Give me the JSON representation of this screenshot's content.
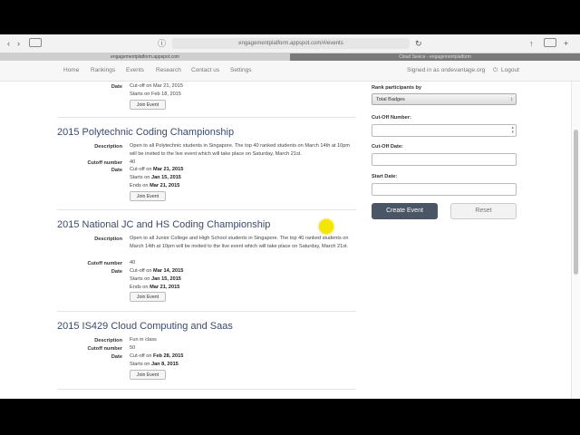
{
  "browser": {
    "url": "engagementplatform.appspot.com/#/events",
    "tab_left": "engagementplatform.appspot.com",
    "tab_right": "Cloud Sevice - engagementplatform"
  },
  "nav": {
    "items": [
      "Home",
      "Rankings",
      "Events",
      "Research",
      "Contact us",
      "Settings"
    ],
    "signed_in": "Signed in as ondevantage.org",
    "logout": "Logout"
  },
  "top_partial": {
    "date_label": "Date",
    "cutoff": "Cut-off on Mar 21, 2015",
    "starts": "Starts on Feb 18, 2015",
    "join": "Join Event"
  },
  "events": [
    {
      "title": "2015 Polytechnic Coding Championship",
      "description": "Open to all Polytechnic students in Singapore. The top 40 ranked students on March 14th at 10pm will be invited to the live event which will take place on Saturday, March 21st.",
      "cutoff_number": "40",
      "cutoff_prefix": "Cut-off on ",
      "cutoff_date": "Mar 21, 2015",
      "starts_prefix": "Starts on ",
      "starts_date": "Jan 15, 2015",
      "ends_prefix": "Ends on ",
      "ends_date": "Mar 21, 2015",
      "join": "Join Event"
    },
    {
      "title": "2015 National JC and HS Coding Championship",
      "description": "Open to all Junior College and High School students in Singapore. The top 40 ranked students on March 14th at 10pm will be invited to the live event which will take place on Saturday, March 21st.",
      "cutoff_number": "40",
      "cutoff_prefix": "Cut-off on ",
      "cutoff_date": "Mar 14, 2015",
      "starts_prefix": "Starts on ",
      "starts_date": "Jan 15, 2015",
      "ends_prefix": "Ends on ",
      "ends_date": "Mar 21, 2015",
      "join": "Join Event"
    },
    {
      "title": "2015 IS429 Cloud Computing and Saas",
      "description": "Fun in class",
      "cutoff_number": "50",
      "cutoff_prefix": "Cut-off on ",
      "cutoff_date": "Feb 28, 2015",
      "starts_prefix": "Starts on ",
      "starts_date": "Jan 8, 2015",
      "join": "Join Event"
    }
  ],
  "labels": {
    "description": "Description",
    "cutoff_number": "Cutoff number",
    "date": "Date"
  },
  "panel": {
    "rank_label": "Rank participants by",
    "rank_value": "Total Badges",
    "cutoff_number_label": "Cut-Off Number:",
    "cutoff_date_label": "Cut-Off Date:",
    "start_date_label": "Start Date:",
    "create_button": "Create Event",
    "reset_button": "Reset"
  }
}
